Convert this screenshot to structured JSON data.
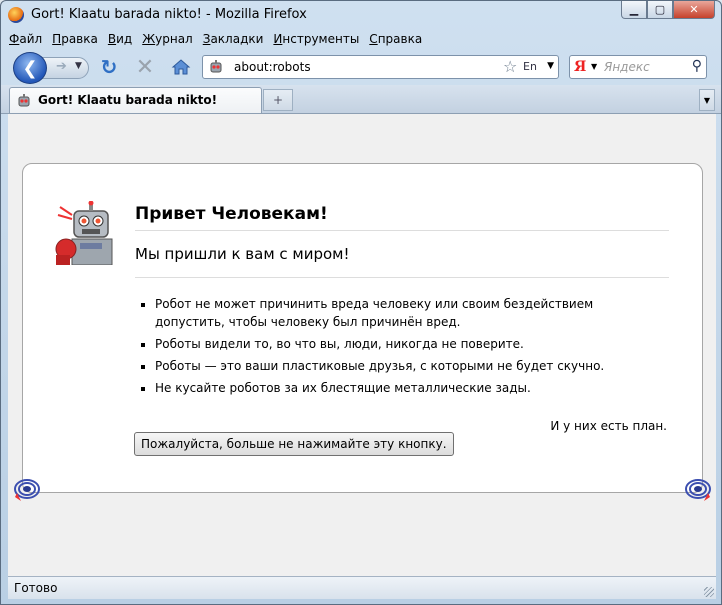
{
  "window": {
    "title": "Gort! Klaatu barada nikto! - Mozilla Firefox"
  },
  "menu": [
    "Файл",
    "Правка",
    "Вид",
    "Журнал",
    "Закладки",
    "Инструменты",
    "Справка"
  ],
  "navbar": {
    "url": "about:robots",
    "search_placeholder": "Яндекс",
    "search_logo": "Я",
    "lang_label": "En"
  },
  "tab": {
    "title": "Gort! Klaatu barada nikto!"
  },
  "page": {
    "heading": "Привет Человекам!",
    "greeting": "Мы пришли к вам с миром!",
    "laws": [
      "Робот не может причинить вреда человеку или своим бездействием допустить, чтобы человеку был причинён вред.",
      "Роботы видели то, во что вы, люди, никогда не поверите.",
      "Роботы — это ваши пластиковые друзья, с которыми не будет скучно.",
      "Не кусайте роботов за их блестящие металлические зады."
    ],
    "plan": "И у них есть план.",
    "button_label": "Пожалуйста, больше не нажимайте эту кнопку."
  },
  "status": {
    "text": "Готово"
  },
  "icons": {
    "app": "firefox-icon",
    "back": "back-arrow-icon",
    "reload": "reload-icon",
    "stop": "stop-icon",
    "home": "home-icon",
    "bookmark": "star-icon",
    "search": "magnifier-icon",
    "speaker": "speaker-icon"
  }
}
